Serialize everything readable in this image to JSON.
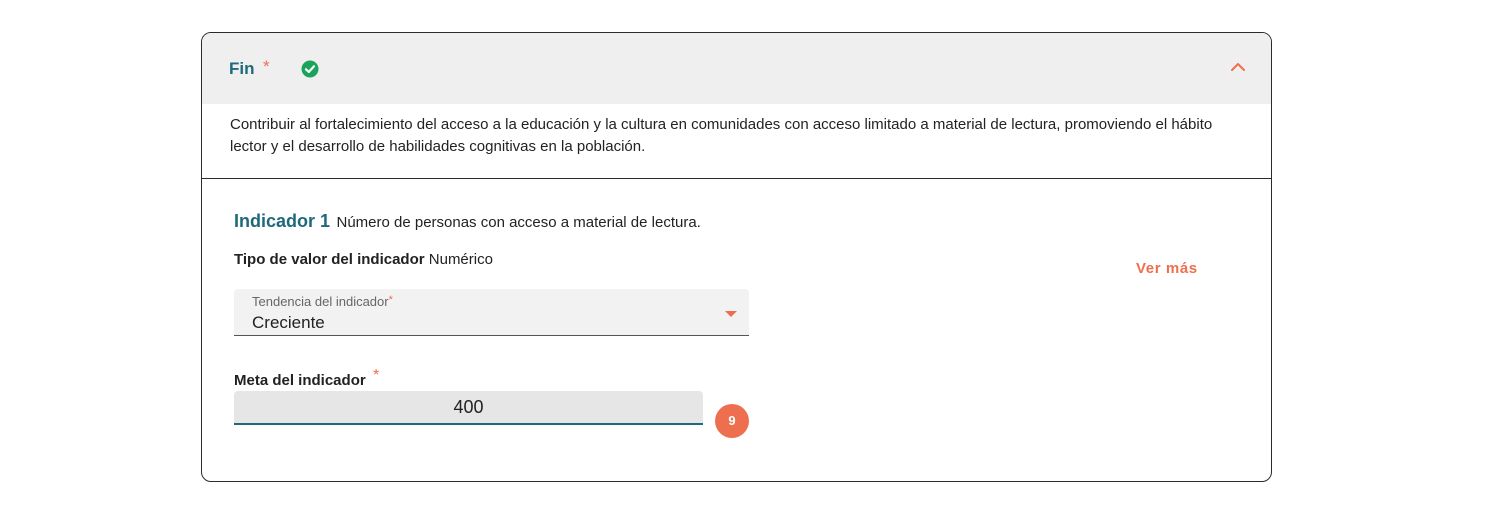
{
  "section": {
    "title": "Fin",
    "required_mark": "*",
    "status_icon": "check-circle-icon",
    "collapse_icon": "chevron-up-icon",
    "description": "Contribuir al fortalecimiento del acceso a la educación y la cultura en comunidades con acceso limitado a material de lectura, promoviendo el hábito lector y el desarrollo de habilidades cognitivas en la población."
  },
  "indicator": {
    "label": "Indicador 1",
    "name": "Número de personas con acceso a material de lectura.",
    "value_type_label": "Tipo de valor del indicador",
    "value_type": "Numérico",
    "see_more": "Ver más",
    "trend": {
      "label": "Tendencia del indicador",
      "required_mark": "*",
      "value": "Creciente"
    },
    "goal": {
      "label": "Meta del indicador",
      "required_mark": "*",
      "value": "400"
    },
    "badge": "9"
  },
  "colors": {
    "accent": "#ee6f4f",
    "title": "#1e6a7a",
    "success": "#1aa35a",
    "header_bg": "#efefef"
  }
}
